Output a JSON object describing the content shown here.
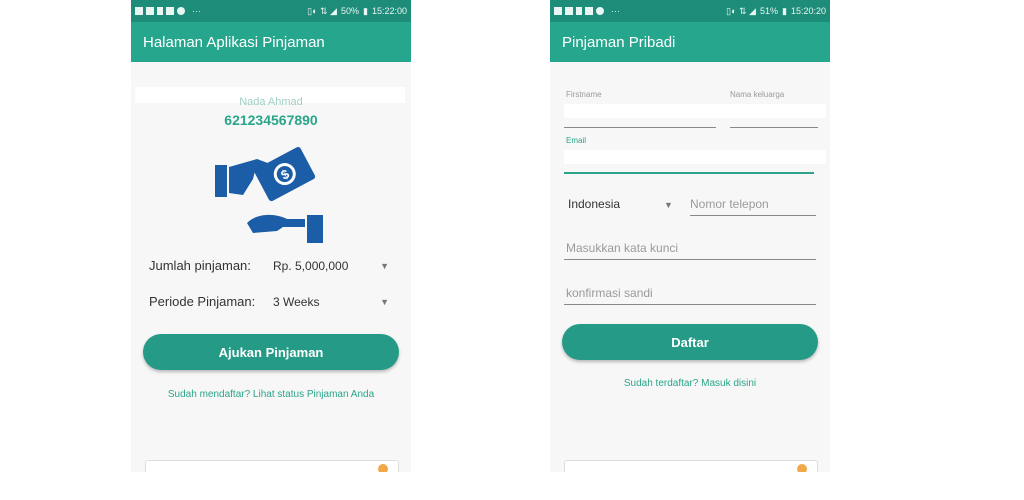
{
  "left": {
    "status": {
      "battery": "50%",
      "time": "15:22:00"
    },
    "title": "Halaman Aplikasi Pinjaman",
    "name_faded": "Nada Ahmad",
    "account": "621234567890",
    "loan_amount": {
      "label": "Jumlah pinjaman:",
      "value": "Rp. 5,000,000"
    },
    "loan_period": {
      "label": "Periode Pinjaman:",
      "value": "3 Weeks"
    },
    "submit": "Ajukan Pinjaman",
    "status_link": "Sudah mendaftar? Lihat status Pinjaman Anda"
  },
  "right": {
    "status": {
      "battery": "51%",
      "time": "15:20:20"
    },
    "title": "Pinjaman Pribadi",
    "firstname_label": "Firstname",
    "lastname_label": "Nama keluarga",
    "email_label": "Email",
    "country": "Indonesia",
    "phone_placeholder": "Nomor telepon",
    "password_placeholder": "Masukkan kata kunci",
    "confirm_placeholder": "konfirmasi sandi",
    "register": "Daftar",
    "login_link": "Sudah terdaftar? Masuk disini"
  },
  "colors": {
    "statusbar": "#1d8c78",
    "appbar": "#26a68c",
    "accent": "#259a86",
    "icon": "#1b5da6"
  }
}
